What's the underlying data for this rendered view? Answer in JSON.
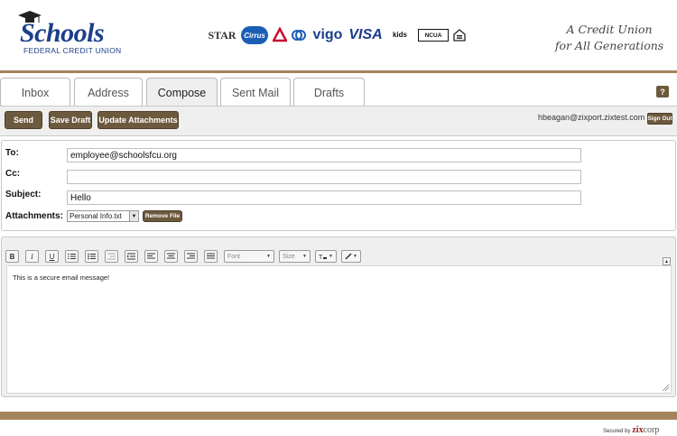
{
  "header": {
    "logo_word": "Schools",
    "logo_sub": "FEDERAL CREDIT UNION",
    "networks": [
      "STAR",
      "Cirrus",
      "vigo",
      "VISA",
      "kids",
      "NCUA"
    ],
    "tagline_line1": "A Credit Union",
    "tagline_line2": "for All Generations"
  },
  "tabs": [
    {
      "label": "Inbox",
      "active": false
    },
    {
      "label": "Address",
      "active": false
    },
    {
      "label": "Compose",
      "active": true
    },
    {
      "label": "Sent Mail",
      "active": false
    },
    {
      "label": "Drafts",
      "active": false
    }
  ],
  "help_label": "?",
  "toolbar": {
    "send_label": "Send",
    "save_draft_label": "Save Draft",
    "update_attachments_label": "Update Attachments",
    "user_email": "hbeagan@zixport.zixtest.com",
    "sign_out_label": "Sign Out"
  },
  "form": {
    "to_label": "To:",
    "to_value": "employee@schoolsfcu.org",
    "cc_label": "Cc:",
    "cc_value": "",
    "subject_label": "Subject:",
    "subject_value": "Hello",
    "attachments_label": "Attachments:",
    "attachment_selected": "Personal Info.txt",
    "remove_file_label": "Remove File"
  },
  "editor": {
    "toolbar_buttons": [
      "B",
      "I",
      "U"
    ],
    "font_placeholder": "Font",
    "size_placeholder": "Size",
    "body_text": "This is a secure email message!"
  },
  "footer": {
    "secured_by": "Secured by",
    "brand_zix": "zix",
    "brand_corp": "corp"
  },
  "colors": {
    "accent_brown": "#6d5a3e",
    "rule_tan": "#a3845e",
    "logo_blue": "#1d3f8a"
  }
}
